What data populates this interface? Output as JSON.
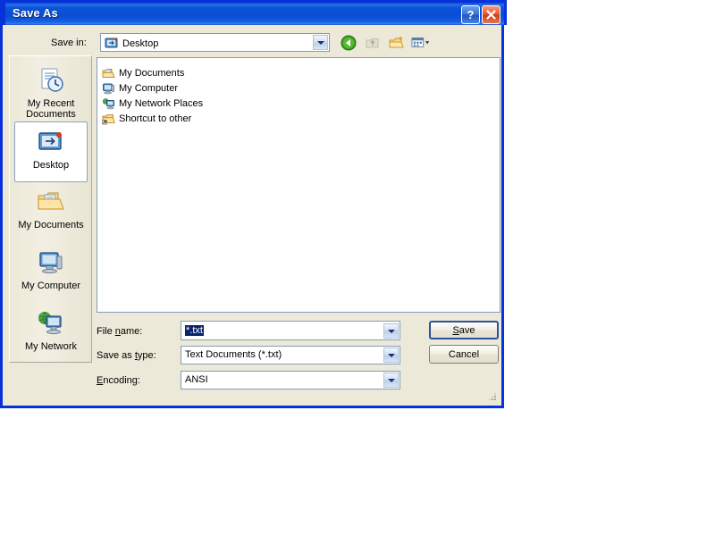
{
  "window": {
    "title": "Save As",
    "help_button": "?",
    "close_button": "×",
    "help_icon": "question-mark-icon",
    "close_icon": "close-x-icon"
  },
  "toolbar": {
    "savein_label": "Save in:",
    "savein_value": "Desktop",
    "savein_icon": "desktop-icon",
    "buttons": [
      {
        "name": "back-button",
        "icon": "back-arrow-icon",
        "enabled": true
      },
      {
        "name": "up-one-level-button",
        "icon": "up-folder-icon",
        "enabled": false
      },
      {
        "name": "new-folder-button",
        "icon": "new-folder-icon",
        "enabled": true
      },
      {
        "name": "views-button",
        "icon": "views-icon",
        "enabled": true
      }
    ]
  },
  "places": [
    {
      "label": "My Recent\nDocuments",
      "icon": "recent-documents-icon",
      "selected": false
    },
    {
      "label": "Desktop",
      "icon": "desktop-icon",
      "selected": true
    },
    {
      "label": "My Documents",
      "icon": "my-documents-icon",
      "selected": false
    },
    {
      "label": "My Computer",
      "icon": "my-computer-icon",
      "selected": false
    },
    {
      "label": "My Network",
      "icon": "my-network-icon",
      "selected": false
    }
  ],
  "file_list": [
    {
      "name": "My Documents",
      "icon": "my-documents-folder-icon"
    },
    {
      "name": "My Computer",
      "icon": "my-computer-icon"
    },
    {
      "name": "My Network Places",
      "icon": "my-network-places-icon"
    },
    {
      "name": "Shortcut to other",
      "icon": "folder-shortcut-icon"
    }
  ],
  "form": {
    "filename_label": "File name:",
    "filename_value": "*.txt",
    "filename_selected": true,
    "filetype_label": "Save as type:",
    "filetype_value": "Text Documents (*.txt)",
    "encoding_label": "Encoding:",
    "encoding_value": "ANSI"
  },
  "buttons": {
    "save": "Save",
    "cancel": "Cancel"
  },
  "colors": {
    "title_bar": "#0a4ed4",
    "window_border": "#0831d9",
    "dialog_face": "#ece9d8",
    "selection": "#0a246a",
    "field_border": "#7f9db9",
    "default_button_border": "#2c4f9e"
  }
}
